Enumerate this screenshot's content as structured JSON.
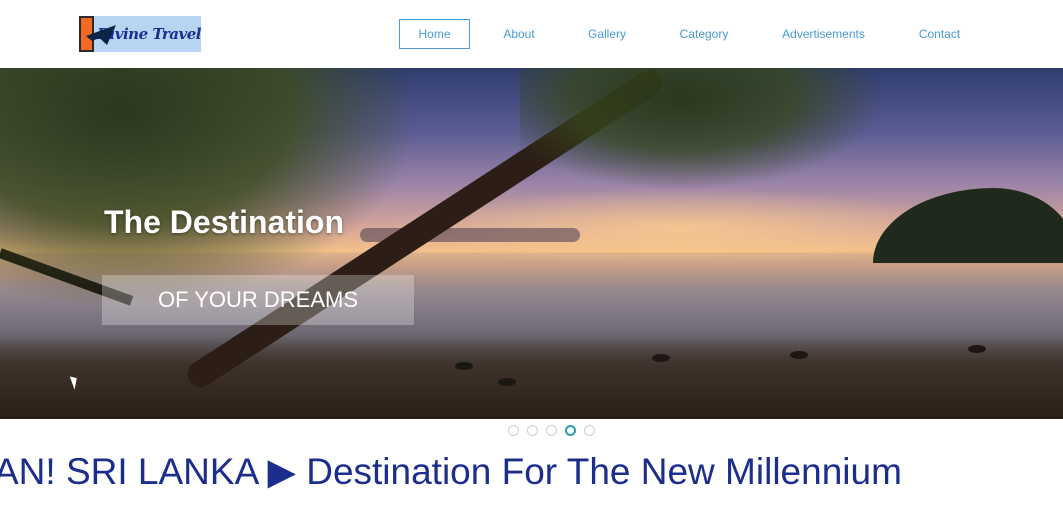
{
  "brand": {
    "logo_text": "Divine Travel"
  },
  "nav": {
    "items": [
      {
        "label": "Home",
        "active": true
      },
      {
        "label": "About",
        "active": false
      },
      {
        "label": "Gallery",
        "active": false
      },
      {
        "label": "Category",
        "active": false
      },
      {
        "label": "Advertisements",
        "active": false
      },
      {
        "label": "Contact",
        "active": false
      }
    ]
  },
  "hero": {
    "title": "The Destination",
    "subtitle": "OF YOUR DREAMS"
  },
  "carousel": {
    "slide_count": 5,
    "active_index": 3,
    "active_color": "#2a9db3"
  },
  "ticker": {
    "text": "AN! SRI LANKA ▶ Destination For The New Millennium"
  },
  "colors": {
    "nav_link": "#4a9ad8",
    "ticker_text": "#1c2e8c"
  }
}
